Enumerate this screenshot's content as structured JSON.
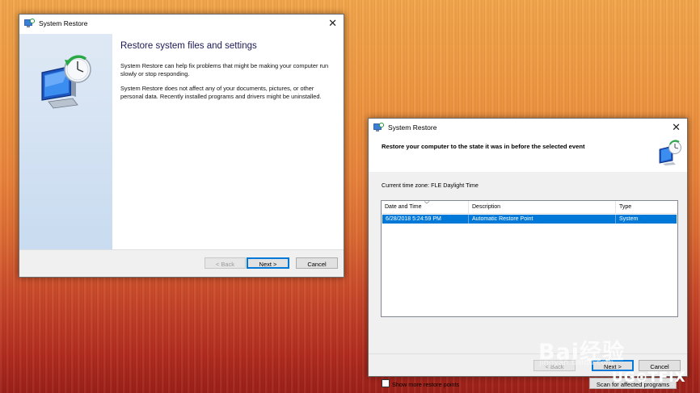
{
  "window1": {
    "title": "System Restore",
    "heading": "Restore system files and settings",
    "paragraph1": "System Restore can help fix problems that might be making your computer run slowly or stop responding.",
    "paragraph2": "System Restore does not affect any of your documents, pictures, or other personal data. Recently installed programs and drivers might be uninstalled.",
    "buttons": {
      "back": "< Back",
      "next": "Next >",
      "cancel": "Cancel"
    }
  },
  "window2": {
    "title": "System Restore",
    "heading": "Restore your computer to the state it was in before the selected event",
    "timezone": "Current time zone: FLE Daylight Time",
    "columns": [
      "Date and Time",
      "Description",
      "Type"
    ],
    "rows": [
      {
        "date": "6/28/2018 5:24:59 PM",
        "description": "Automatic Restore Point",
        "type": "System",
        "selected": true
      }
    ],
    "checkbox_label": "Show more restore points",
    "scan_button": "Scan for affected programs",
    "buttons": {
      "back": "< Back",
      "next": "Next >",
      "cancel": "Cancel"
    }
  },
  "watermarks": {
    "baidu": "Bai经验",
    "baidu_sub": "jingyan.baidu.com",
    "fix": "UG⊙TFIX"
  },
  "colors": {
    "accent": "#0078d7",
    "selection": "#0078d7",
    "heading_blue": "#1a1a55"
  },
  "icons": [
    "system-restore-icon",
    "close-icon",
    "monitor-clock-icon",
    "sort-arrow-icon"
  ]
}
